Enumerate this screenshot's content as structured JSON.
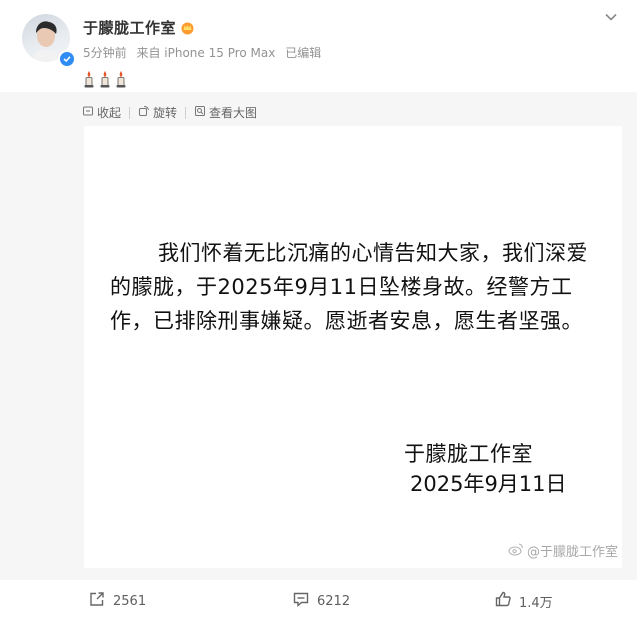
{
  "post": {
    "author_name": "于朦胧工作室",
    "time": "5分钟前",
    "source": "来自 iPhone 15 Pro Max",
    "edited": "已编辑",
    "content_emojis": [
      "candle-emoji",
      "candle-emoji",
      "candle-emoji"
    ]
  },
  "repost_toolbar": {
    "collapse_label": "收起",
    "rotate_label": "旋转",
    "view_large_label": "查看大图"
  },
  "image": {
    "statement_text": "我们怀着无比沉痛的心情告知大家，我们深爱的朦胧，于2025年9月11日坠楼身故。经警方工作，已排除刑事嫌疑。愿逝者安息，愿生者坚强。",
    "signature_name": "于朦胧工作室",
    "signature_date": "2025年9月11日",
    "watermark": "@于朦胧工作室"
  },
  "actions": {
    "repost_count": "2561",
    "comment_count": "6212",
    "like_count": "1.4万"
  },
  "colors": {
    "verified": "#2f8cf5",
    "meta_text": "#939393",
    "panel_bg": "#f6f6f6"
  }
}
